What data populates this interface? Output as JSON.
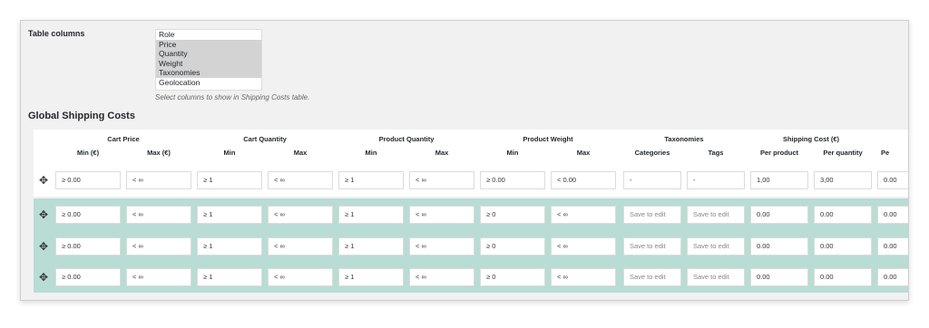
{
  "settings": {
    "label": "Table columns",
    "options": [
      {
        "label": "Role",
        "selected": false
      },
      {
        "label": "Price",
        "selected": true
      },
      {
        "label": "Quantity",
        "selected": true
      },
      {
        "label": "Weight",
        "selected": true
      },
      {
        "label": "Taxonomies",
        "selected": true
      },
      {
        "label": "Geolocation",
        "selected": false
      }
    ],
    "hint": "Select columns to show in Shipping Costs table."
  },
  "section_title": "Global Shipping Costs",
  "table": {
    "groups": [
      "Cart Price",
      "Cart Quantity",
      "Product Quantity",
      "Product Weight",
      "Taxonomies",
      "Shipping Cost (€)"
    ],
    "columns": [
      "Min (€)",
      "Max (€)",
      "Min",
      "Max",
      "Min",
      "Max",
      "Min",
      "Max",
      "Categories",
      "Tags",
      "Per product",
      "Per quantity",
      "Pe"
    ],
    "rows": [
      [
        "≥  0.00",
        "<  ∞",
        "≥  1",
        "<  ∞",
        "≥  1",
        "<  ∞",
        "≥  0.00",
        "<  0.00",
        "-",
        "-",
        "1,00",
        "3,00",
        "0.00"
      ],
      [
        "≥  0.00",
        "<  ∞",
        "≥  1",
        "<  ∞",
        "≥  1",
        "<  ∞",
        "≥  0",
        "<  ∞",
        "Save to edit",
        "Save to edit",
        "0.00",
        "0.00",
        "0.00"
      ],
      [
        "≥  0.00",
        "<  ∞",
        "≥  1",
        "<  ∞",
        "≥  1",
        "<  ∞",
        "≥  0",
        "<  ∞",
        "Save to edit",
        "Save to edit",
        "0.00",
        "0.00",
        "0.00"
      ],
      [
        "≥  0.00",
        "<  ∞",
        "≥  1",
        "<  ∞",
        "≥  1",
        "<  ∞",
        "≥  0",
        "<  ∞",
        "Save to edit",
        "Save to edit",
        "0.00",
        "0.00",
        "0.00"
      ]
    ]
  },
  "icons": {
    "drag_handle": "move-icon"
  }
}
